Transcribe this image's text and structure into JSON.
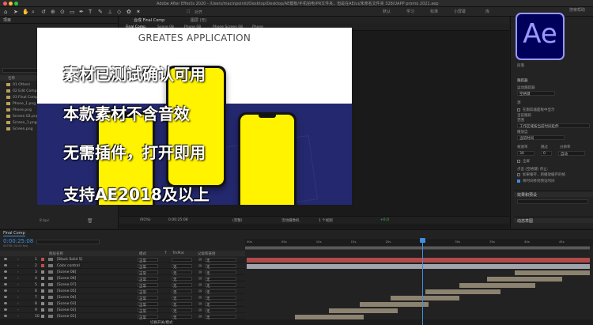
{
  "window": {
    "title": "Adobe After Effects 2020 - /Users/macinpoiniit/Desktop/Desktop/AE模板/手机拍电/PR文件夹，但是在AE/ui/未命名文件夹 328/UAPP promo 2021.aep"
  },
  "workspaces": [
    {
      "label": "默认",
      "active": false
    },
    {
      "label": "学习",
      "active": false
    },
    {
      "label": "标准",
      "active": false
    },
    {
      "label": "小屏幕",
      "active": false
    },
    {
      "label": "库",
      "active": false
    },
    {
      "label": "搜索帮助",
      "active": false
    }
  ],
  "toolbar": {
    "snap_label": "对齐"
  },
  "project_panel": {
    "title": "项目",
    "columns": {
      "name": "名称",
      "type": "类型",
      "size": "大小"
    },
    "rows": [
      {
        "name": "01 Others",
        "type": "文件夹",
        "size": ""
      },
      {
        "name": "02 Edit Comp",
        "type": "文件夹",
        "size": ""
      },
      {
        "name": "03 Final Comp",
        "type": "文件夹",
        "size": ""
      },
      {
        "name": "Phone_1.png",
        "type": "",
        "size": ""
      },
      {
        "name": "Phone.png",
        "type": "",
        "size": ""
      },
      {
        "name": "Screen 02.png",
        "type": "",
        "size": ""
      },
      {
        "name": "Screen_1.png",
        "type": "PNG 文件",
        "size": "999 K"
      },
      {
        "name": "Screen.png",
        "type": "PNG 文件",
        "size": "999 K"
      }
    ],
    "footer_bpc": "8 bpc"
  },
  "composition_panel": {
    "tab_label": "合成 Final Comp",
    "layer_tab": "图层 (无)",
    "subtabs": [
      {
        "label": "Final Comp",
        "active": true
      },
      {
        "label": "Scene 08",
        "active": false
      },
      {
        "label": "Phone 08",
        "active": false
      },
      {
        "label": "Phone Screen 08",
        "active": false
      },
      {
        "label": "Phone",
        "active": false
      }
    ],
    "viewer": {
      "heading": "GREATES APPLICATION",
      "colors": {
        "background": "#ffffff",
        "band": "#24286e",
        "screen": "#fff300",
        "phone_body": "#141414"
      }
    },
    "viewer_bar": {
      "zoom": "(91%)",
      "timecode": "0:00:25:08",
      "resolution": "(完整)",
      "camera": "活动摄像机",
      "views": "1 个视图",
      "exposure": "+0.0"
    }
  },
  "overlay_text": [
    "素材已测试确认可用",
    "本款素材不含音效",
    "无需插件，打开即用",
    "支持AE2018及以上"
  ],
  "right_panel": {
    "logo_text": "Ae",
    "paragraph_label": "段落",
    "tracker_title": "跟踪器",
    "motion_label": "运动跟踪器",
    "motion_options": [
      {
        "label": "在跟踪器面板中显示",
        "checked": false
      }
    ],
    "source_label": "源",
    "source_value": "空格键",
    "current_track_label": "当前跟踪",
    "range_label": "范围",
    "range_value": "工作区域按当前时间延伸",
    "playback_label": "播放自",
    "playback_value": "当前时间",
    "speed_label": "帧速率",
    "speed_value": "30",
    "skip_label": "跳过",
    "skip_value": "0",
    "resolution_label": "分辨率",
    "resolution_value": "自动",
    "fullscreen_label": "全屏",
    "hint_label": "点击 (空格键) 停止:",
    "options": [
      {
        "label": "如果缓存，则播放缓存的帧",
        "checked": false
      },
      {
        "label": "将时间移到预览时间",
        "checked": true
      }
    ],
    "effects_section": "效果和预设",
    "align_section": "动态草图"
  },
  "timeline": {
    "tab_label": "Final Comp",
    "timecode": "0:00:25:08",
    "fps_note": "00758 (30.00 fps)",
    "columns": {
      "name": "图层名称",
      "mode": "模式",
      "t": "T",
      "trkmat": "TrkMat",
      "parent": "父级和链接"
    },
    "ruler_ticks": [
      "00s",
      "05s",
      "10s",
      "15s",
      "20s",
      "25s",
      "30s",
      "35s",
      "40s",
      "45s"
    ],
    "layers": [
      {
        "num": "1",
        "name": "[Black Solid 5]",
        "mode": "正常",
        "trkmat": "",
        "parent": "无",
        "color": "#c44b4b",
        "bar_color": "#b24a4a",
        "bar_start": 0.0,
        "bar_end": 1.0
      },
      {
        "num": "2",
        "name": "Color control",
        "mode": "正常",
        "trkmat": "无",
        "parent": "无",
        "color": "#c44b4b",
        "bar_color": "#9fa4ad",
        "bar_start": 0.0,
        "bar_end": 1.0
      },
      {
        "num": "3",
        "name": "[Scene 08]",
        "mode": "正常",
        "trkmat": "无",
        "parent": "无",
        "color": "#8a8a8a",
        "bar_color": "#8c8270",
        "bar_start": 0.78,
        "bar_end": 1.0
      },
      {
        "num": "4",
        "name": "[Scene 06]",
        "mode": "正常",
        "trkmat": "无",
        "parent": "无",
        "color": "#8a8a8a",
        "bar_color": "#8c8270",
        "bar_start": 0.7,
        "bar_end": 0.92
      },
      {
        "num": "5",
        "name": "[Scene 07]",
        "mode": "正常",
        "trkmat": "无",
        "parent": "无",
        "color": "#8a8a8a",
        "bar_color": "#8c8270",
        "bar_start": 0.62,
        "bar_end": 0.84
      },
      {
        "num": "6",
        "name": "[Scene 05]",
        "mode": "正常",
        "trkmat": "无",
        "parent": "无",
        "color": "#8a8a8a",
        "bar_color": "#8c8270",
        "bar_start": 0.52,
        "bar_end": 0.74
      },
      {
        "num": "7",
        "name": "[Scene 04]",
        "mode": "正常",
        "trkmat": "无",
        "parent": "无",
        "color": "#8a8a8a",
        "bar_color": "#8c8270",
        "bar_start": 0.42,
        "bar_end": 0.62
      },
      {
        "num": "8",
        "name": "[Scene 03]",
        "mode": "正常",
        "trkmat": "无",
        "parent": "无",
        "color": "#8a8a8a",
        "bar_color": "#8c8270",
        "bar_start": 0.33,
        "bar_end": 0.53
      },
      {
        "num": "9",
        "name": "[Scene 02]",
        "mode": "正常",
        "trkmat": "无",
        "parent": "无",
        "color": "#8a8a8a",
        "bar_color": "#8c8270",
        "bar_start": 0.24,
        "bar_end": 0.44
      },
      {
        "num": "10",
        "name": "[Scene 01]",
        "mode": "正常",
        "trkmat": "无",
        "parent": "无",
        "color": "#8a8a8a",
        "bar_color": "#8c8270",
        "bar_start": 0.14,
        "bar_end": 0.34
      }
    ],
    "footer_label": "切换开关/模式"
  }
}
